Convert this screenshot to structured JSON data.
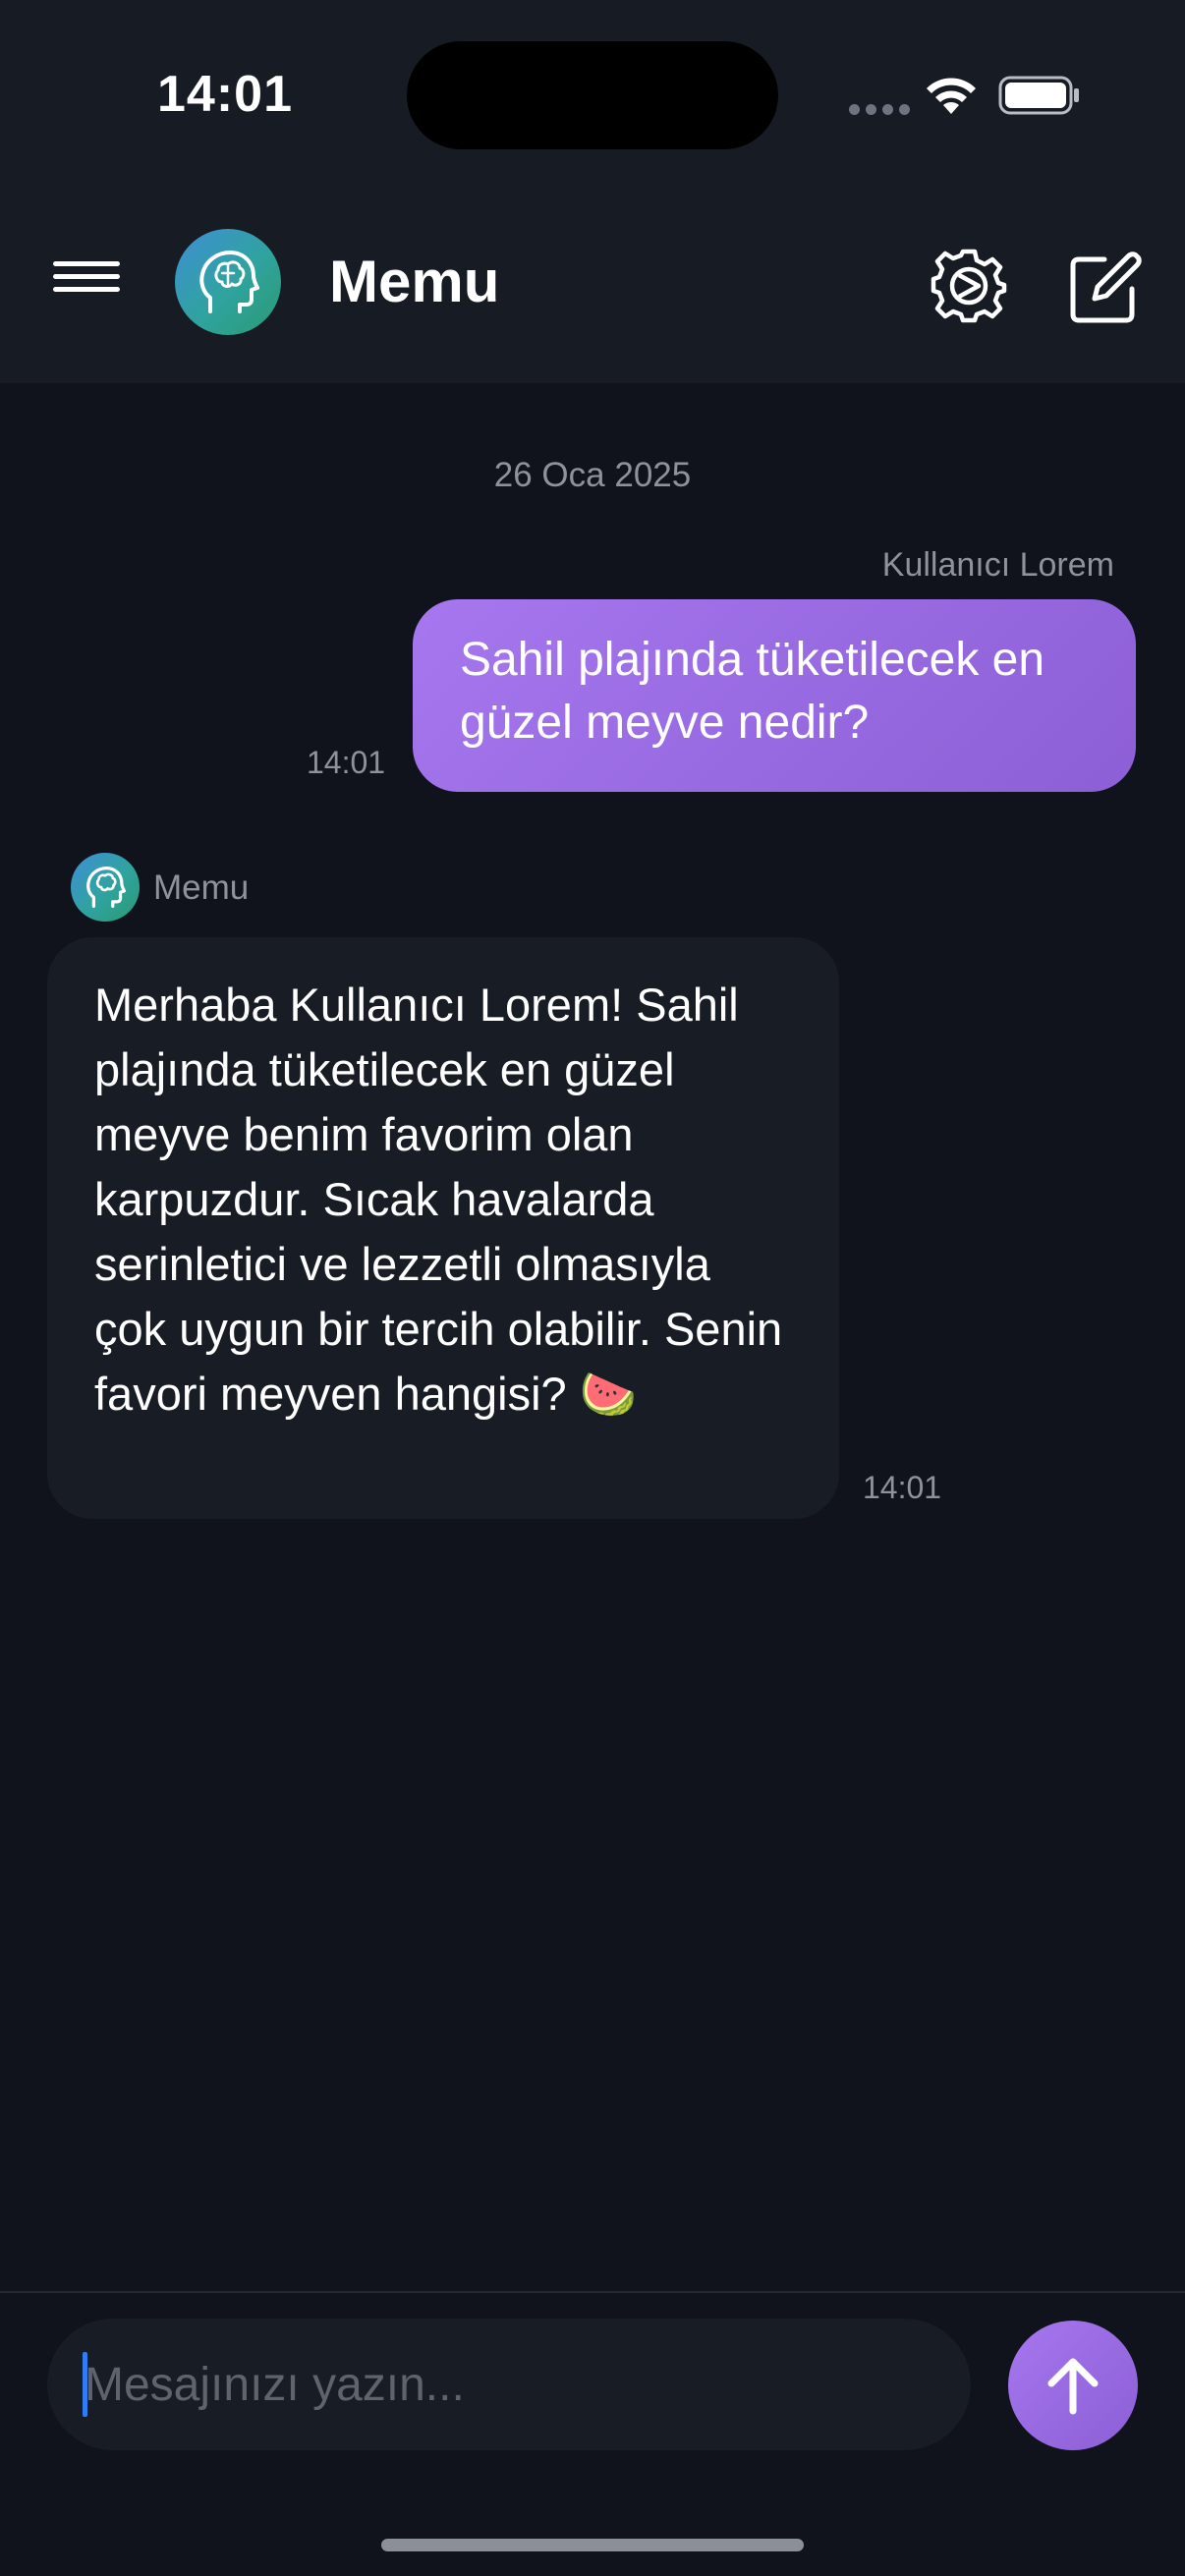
{
  "status_bar": {
    "time": "14:01"
  },
  "header": {
    "title": "Memu",
    "menu_icon": "hamburger-menu-icon",
    "avatar_icon": "brain-head-icon",
    "settings_icon": "gear-icon",
    "compose_icon": "compose-icon"
  },
  "chat": {
    "date_separator": "26 Oca 2025",
    "messages": [
      {
        "sender": "Kullanıcı Lorem",
        "text": "Sahil plajında tüketilecek en güzel meyve nedir?",
        "time": "14:01"
      },
      {
        "sender": "Memu",
        "text": "Merhaba Kullanıcı Lorem! Sahil plajında tüketilecek en güzel meyve benim favorim olan karpuzdur. Sıcak havalarda serinletici ve lezzetli olmasıyla çok uygun bir tercih olabilir. Senin favori meyven hangisi? 🍉",
        "time": "14:01"
      }
    ]
  },
  "composer": {
    "placeholder": "Mesajınızı yazın...",
    "send_icon": "arrow-up-icon"
  },
  "colors": {
    "accent": "#9b6be6",
    "background": "#10131b",
    "surface": "#181c24",
    "muted_text": "#8d929c"
  }
}
